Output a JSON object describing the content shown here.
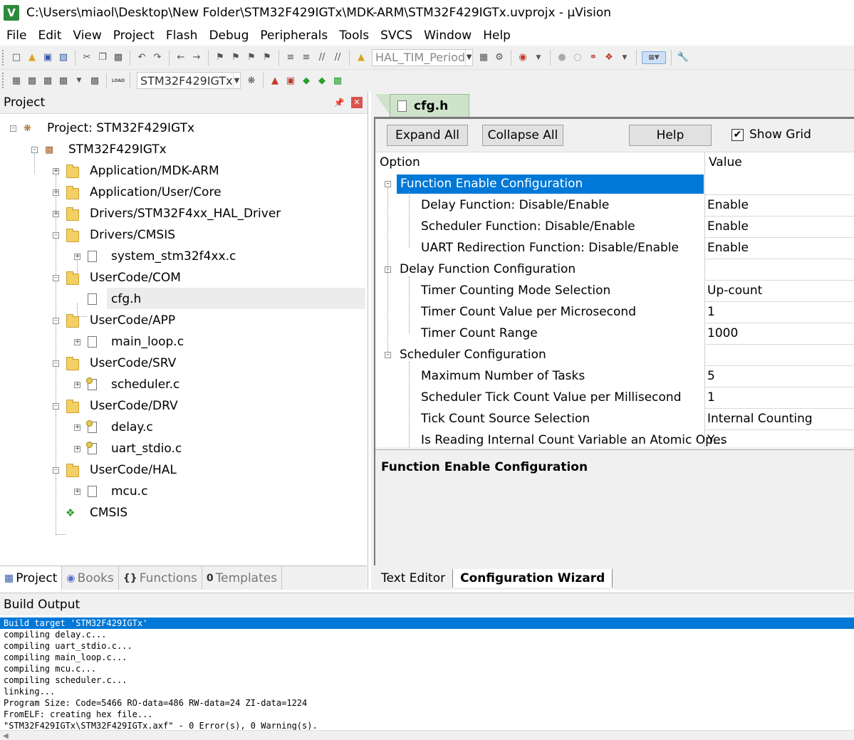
{
  "window": {
    "title": "C:\\Users\\miaol\\Desktop\\New Folder\\STM32F429IGTx\\MDK-ARM\\STM32F429IGTx.uvprojx - µVision",
    "app_icon": "V"
  },
  "menu": [
    "File",
    "Edit",
    "View",
    "Project",
    "Flash",
    "Debug",
    "Peripherals",
    "Tools",
    "SVCS",
    "Window",
    "Help"
  ],
  "toolbar1": {
    "find_combo": "HAL_TIM_Period"
  },
  "toolbar2": {
    "target_combo": "STM32F429IGTx",
    "load_label": "LOAD"
  },
  "project_panel": {
    "title": "Project",
    "tree": {
      "root": "Project: STM32F429IGTx",
      "target": "STM32F429IGTx",
      "groups": [
        {
          "name": "Application/MDK-ARM",
          "files": []
        },
        {
          "name": "Application/User/Core",
          "files": []
        },
        {
          "name": "Drivers/STM32F4xx_HAL_Driver",
          "files": []
        },
        {
          "name": "Drivers/CMSIS",
          "files": [
            "system_stm32f4xx.c"
          ]
        },
        {
          "name": "UserCode/COM",
          "files": [
            "cfg.h"
          ]
        },
        {
          "name": "UserCode/APP",
          "files": [
            "main_loop.c"
          ]
        },
        {
          "name": "UserCode/SRV",
          "files": [
            "scheduler.c"
          ]
        },
        {
          "name": "UserCode/DRV",
          "files": [
            "delay.c",
            "uart_stdio.c"
          ]
        },
        {
          "name": "UserCode/HAL",
          "files": [
            "mcu.c"
          ]
        }
      ],
      "component": "CMSIS"
    },
    "tabs": [
      {
        "label": "Project",
        "icon": "project-icon"
      },
      {
        "label": "Books",
        "icon": "books-icon"
      },
      {
        "label": "Functions",
        "icon": "functions-icon"
      },
      {
        "label": "Templates",
        "icon": "templates-icon"
      }
    ]
  },
  "editor": {
    "file_tab": "cfg.h",
    "buttons": {
      "expand_all": "Expand All",
      "collapse_all": "Collapse All",
      "help": "Help"
    },
    "show_grid": {
      "label": "Show Grid",
      "checked": true
    },
    "columns": {
      "option": "Option",
      "value": "Value"
    },
    "rows": [
      {
        "option": "Function Enable Configuration",
        "value": "",
        "group": true,
        "selected": true
      },
      {
        "option": "Delay Function: Disable/Enable",
        "value": "Enable"
      },
      {
        "option": "Scheduler Function: Disable/Enable",
        "value": "Enable"
      },
      {
        "option": "UART Redirection Function: Disable/Enable",
        "value": "Enable"
      },
      {
        "option": "Delay Function Configuration",
        "value": "",
        "group": true
      },
      {
        "option": "Timer Counting Mode Selection",
        "value": "Up-count"
      },
      {
        "option": "Timer Count Value per Microsecond",
        "value": "1"
      },
      {
        "option": "Timer Count Range",
        "value": "1000"
      },
      {
        "option": "Scheduler Configuration",
        "value": "",
        "group": true
      },
      {
        "option": "Maximum Number of Tasks",
        "value": "5"
      },
      {
        "option": "Scheduler Tick Count Value per Millisecond",
        "value": "1"
      },
      {
        "option": "Tick Count Source Selection",
        "value": "Internal Counting"
      },
      {
        "option": "Is Reading Internal Count Variable an Atomic Op...",
        "value": "Yes"
      }
    ],
    "description_title": "Function Enable Configuration",
    "bottom_tabs": {
      "text_editor": "Text Editor",
      "config_wizard": "Configuration Wizard"
    }
  },
  "build_output": {
    "title": "Build Output",
    "lines": [
      "Build target 'STM32F429IGTx'",
      "compiling delay.c...",
      "compiling uart_stdio.c...",
      "compiling main_loop.c...",
      "compiling mcu.c...",
      "compiling scheduler.c...",
      "linking...",
      "Program Size: Code=5466 RO-data=486 RW-data=24 ZI-data=1224",
      "FromELF: creating hex file...",
      "\"STM32F429IGTx\\STM32F429IGTx.axf\" - 0 Error(s), 0 Warning(s)."
    ]
  },
  "colors": {
    "selection": "#0078d7",
    "tab_active": "#cfe3cb",
    "close": "#d9534f"
  }
}
